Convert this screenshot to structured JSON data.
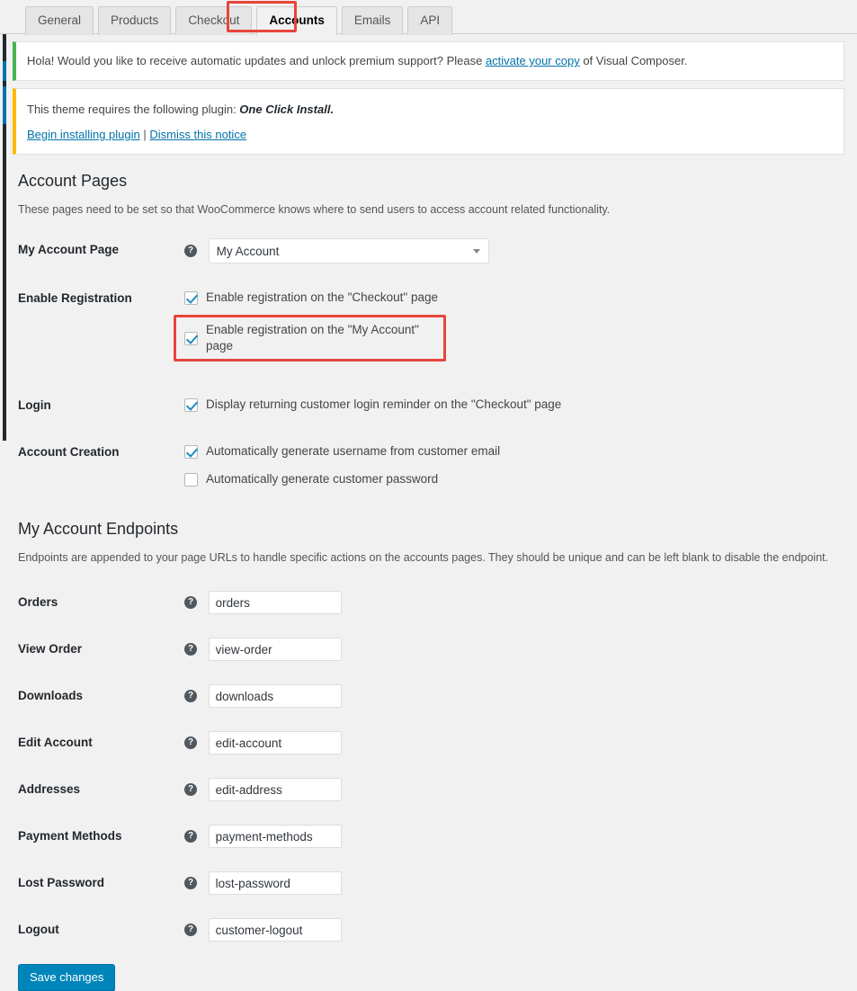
{
  "tabs": [
    {
      "label": "General",
      "active": false
    },
    {
      "label": "Products",
      "active": false
    },
    {
      "label": "Checkout",
      "active": false
    },
    {
      "label": "Accounts",
      "active": true
    },
    {
      "label": "Emails",
      "active": false
    },
    {
      "label": "API",
      "active": false
    }
  ],
  "notices": {
    "updates": {
      "text_before": "Hola! Would you like to receive automatic updates and unlock premium support? Please ",
      "link": "activate your copy",
      "text_after": " of Visual Composer.",
      "accent_color": "#46b450"
    },
    "plugin": {
      "text_before": "This theme requires the following plugin: ",
      "plugin_name": "One Click Install.",
      "link_install": "Begin installing plugin",
      "separator": "|",
      "link_dismiss": "Dismiss this notice",
      "accent_color": "#ffb900"
    }
  },
  "account_pages": {
    "heading": "Account Pages",
    "description": "These pages need to be set so that WooCommerce knows where to send users to access account related functionality.",
    "my_account_page": {
      "label": "My Account Page",
      "help": "?",
      "value": "My Account"
    },
    "enable_registration": {
      "label": "Enable Registration",
      "options": [
        {
          "label": "Enable registration on the \"Checkout\" page",
          "checked": true,
          "highlighted": false
        },
        {
          "label": "Enable registration on the \"My Account\" page",
          "checked": true,
          "highlighted": true
        }
      ]
    },
    "login": {
      "label": "Login",
      "options": [
        {
          "label": "Display returning customer login reminder on the \"Checkout\" page",
          "checked": true,
          "highlighted": false
        }
      ]
    },
    "account_creation": {
      "label": "Account Creation",
      "options": [
        {
          "label": "Automatically generate username from customer email",
          "checked": true,
          "highlighted": false
        },
        {
          "label": "Automatically generate customer password",
          "checked": false,
          "highlighted": false
        }
      ]
    }
  },
  "endpoints": {
    "heading": "My Account Endpoints",
    "description": "Endpoints are appended to your page URLs to handle specific actions on the accounts pages. They should be unique and can be left blank to disable the endpoint.",
    "help": "?",
    "rows": [
      {
        "label": "Orders",
        "value": "orders",
        "placeholder": "orders"
      },
      {
        "label": "View Order",
        "value": "view-order",
        "placeholder": "view-order"
      },
      {
        "label": "Downloads",
        "value": "downloads",
        "placeholder": "downloads"
      },
      {
        "label": "Edit Account",
        "value": "edit-account",
        "placeholder": "edit-account"
      },
      {
        "label": "Addresses",
        "value": "edit-address",
        "placeholder": "edit-address"
      },
      {
        "label": "Payment Methods",
        "value": "payment-methods",
        "placeholder": "payment-methods"
      },
      {
        "label": "Lost Password",
        "value": "lost-password",
        "placeholder": "lost-password"
      },
      {
        "label": "Logout",
        "value": "customer-logout",
        "placeholder": "customer-logout"
      }
    ]
  },
  "submit": {
    "save_label": "Save changes",
    "color": "#0085ba"
  },
  "highlight_color": "#e8453c"
}
